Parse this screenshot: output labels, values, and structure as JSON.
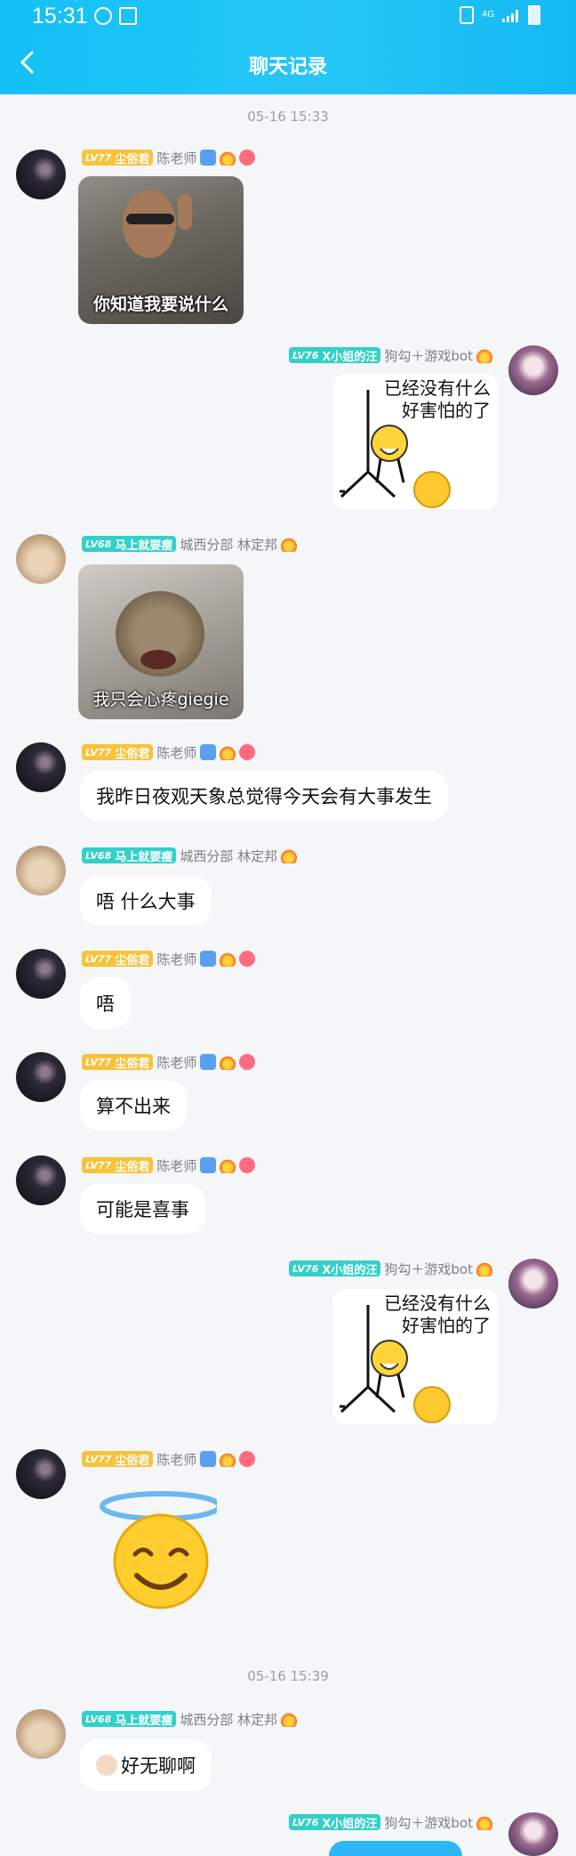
{
  "status": {
    "time": "15:31",
    "network": "4G"
  },
  "header": {
    "title": "聊天记录"
  },
  "timestamps": [
    "05-16 15:33",
    "05-16 15:39"
  ],
  "users": {
    "chen": {
      "level": "LV77",
      "badge": "尘俗君",
      "name": "陈老师"
    },
    "lin": {
      "level": "LV68",
      "badge": "马上就要瘦",
      "name": "城西分部 林定邦"
    },
    "x": {
      "level": "LV76",
      "badge": "X小姐的汪",
      "name": "狗勾＋游戏bot"
    }
  },
  "messages": [
    {
      "text": "你知道我要说什么"
    },
    {
      "text": "已经没有什么好害怕的了"
    },
    {
      "text": "我只会心疼giegie"
    },
    {
      "text": "我昨日夜观天象总觉得今天会有大事发生"
    },
    {
      "text": "唔 什么大事"
    },
    {
      "text": "唔"
    },
    {
      "text": "算不出来"
    },
    {
      "text": "可能是喜事"
    },
    {
      "text": "已经没有什么好害怕的了"
    },
    {
      "text": "好无聊啊"
    }
  ],
  "sticker_lines": [
    "已经没有什么",
    "好害怕的了"
  ],
  "colors": {
    "accent": "#26c7f8",
    "gold_badge": "#f8c23b",
    "teal_badge": "#32d0c8"
  }
}
